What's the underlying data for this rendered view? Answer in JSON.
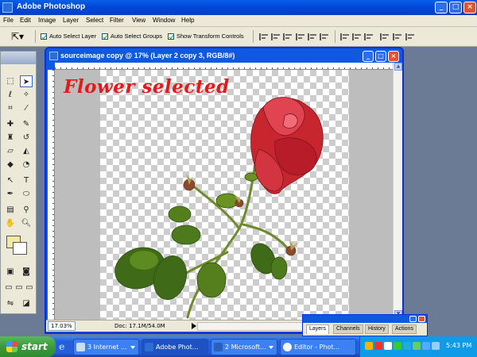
{
  "app": {
    "title": "Adobe Photoshop"
  },
  "menu": [
    "File",
    "Edit",
    "Image",
    "Layer",
    "Select",
    "Filter",
    "View",
    "Window",
    "Help"
  ],
  "options": {
    "auto_select_layer": "Auto Select Layer",
    "auto_select_groups": "Auto Select Groups",
    "show_transform_controls": "Show Transform Controls"
  },
  "document": {
    "title": "sourceimage copy @ 17% (Layer 2 copy 3, RGB/8#)",
    "overlay_text": "Flower selected",
    "zoom": "17.03%",
    "doc_info": "Doc: 17.1M/54.0M"
  },
  "layers_palette": {
    "tabs": [
      "Layers",
      "Channels",
      "History",
      "Actions"
    ]
  },
  "taskbar": {
    "start": "start",
    "tasks": [
      "3 Internet ...",
      "Adobe Phot...",
      "2 Microsoft...",
      "Editor - Phot..."
    ],
    "clock": "5:43 PM"
  },
  "colors": {
    "flower": "#d42a35",
    "overlay_text": "#e41a1a",
    "xp_blue": "#0f58e0",
    "start_green": "#3c9a3d"
  }
}
